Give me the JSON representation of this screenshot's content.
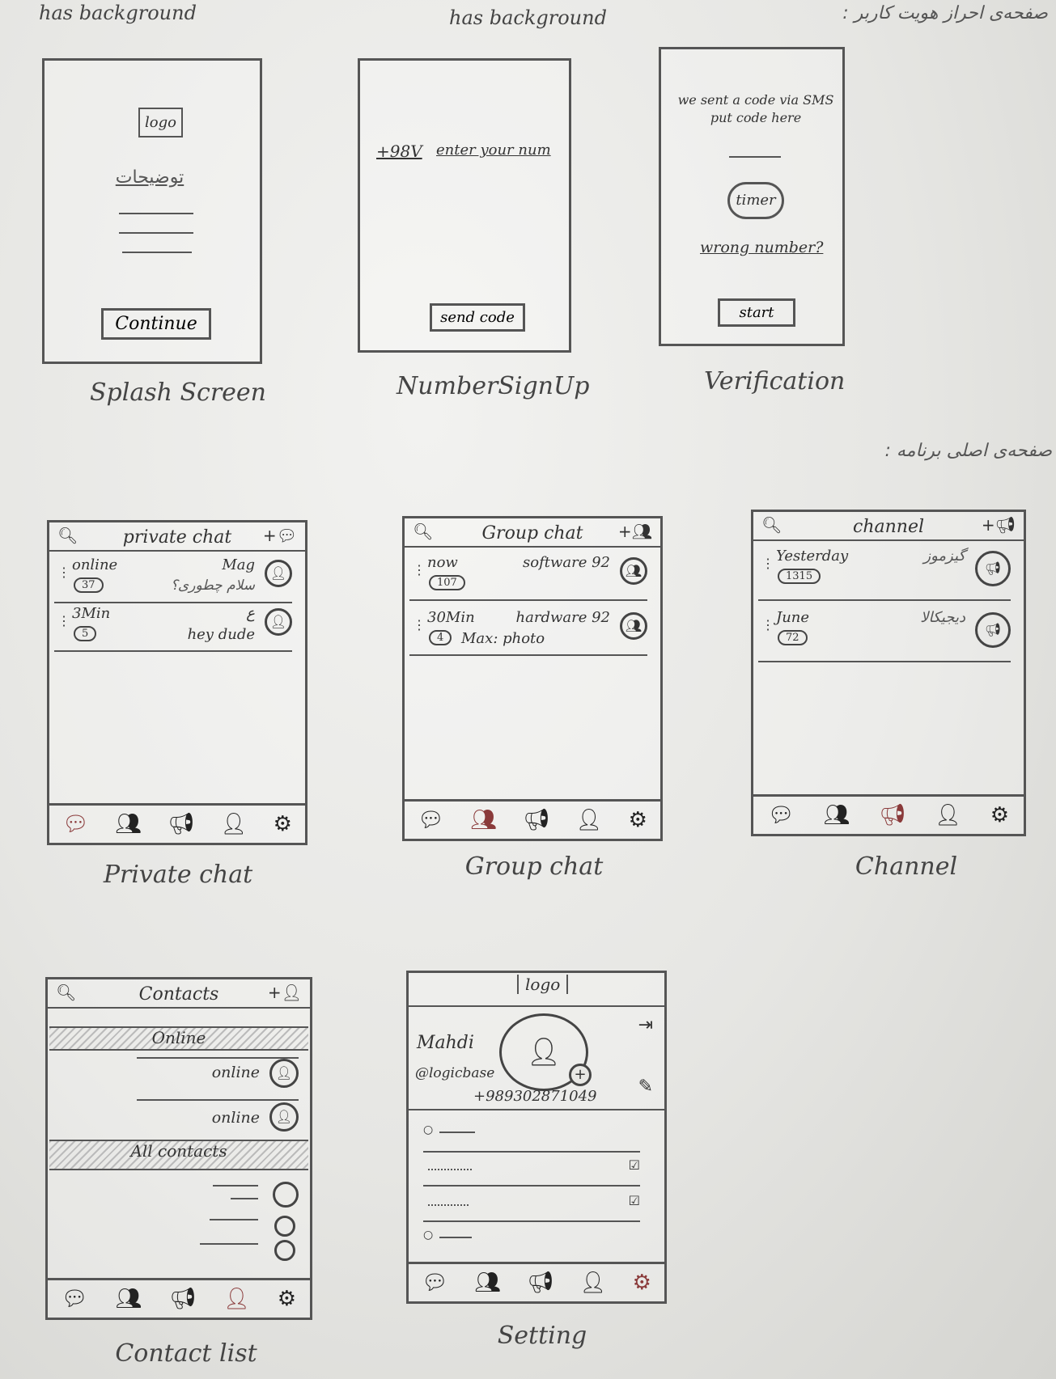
{
  "annotations": {
    "has_background_1": "has background",
    "has_background_2": "has background",
    "top_right_persian": "صفحه‌ی احراز هویت کاربر :",
    "main_pages_persian": "صفحه‌ی اصلی برنامه :"
  },
  "splash": {
    "logo": "logo",
    "persian_text": "توضیحات",
    "continue_label": "Continue",
    "caption": "Splash Screen"
  },
  "numbersignup": {
    "country_code": "+98V",
    "number_placeholder": "enter your num",
    "send_label": "send code",
    "caption": "NumberSignUp"
  },
  "verification": {
    "message": "we sent a code via SMS put code here",
    "timer": "timer",
    "wrong_number": "wrong number?",
    "start_label": "start",
    "caption": "Verification"
  },
  "private_chat": {
    "title": "private chat",
    "rows": [
      {
        "time": "online",
        "badge": "37",
        "name": "Mag",
        "message": "سلام چطوری؟"
      },
      {
        "time": "3Min",
        "badge": "5",
        "name": "ع",
        "message": "hey dude"
      }
    ],
    "caption": "Private chat"
  },
  "group_chat": {
    "title": "Group chat",
    "rows": [
      {
        "time": "now",
        "badge": "107",
        "name": "software 92",
        "message": ""
      },
      {
        "time": "30Min",
        "badge": "4",
        "name": "hardware 92",
        "message": "Max: photo"
      }
    ],
    "caption": "Group chat"
  },
  "channel": {
    "title": "channel",
    "rows": [
      {
        "time": "Yesterday",
        "badge": "1315",
        "name": "گیزموز",
        "message": ""
      },
      {
        "time": "June",
        "badge": "72",
        "name": "دیجیکالا",
        "message": ""
      }
    ],
    "caption": "Channel"
  },
  "contacts": {
    "title": "Contacts",
    "online_header": "Online",
    "online_items": [
      "online",
      "online"
    ],
    "all_header": "All contacts",
    "caption": "Contact list"
  },
  "setting": {
    "logo": "logo",
    "name": "Mahdi",
    "handle": "@logicbase",
    "phone": "+989302871049",
    "caption": "Setting"
  }
}
